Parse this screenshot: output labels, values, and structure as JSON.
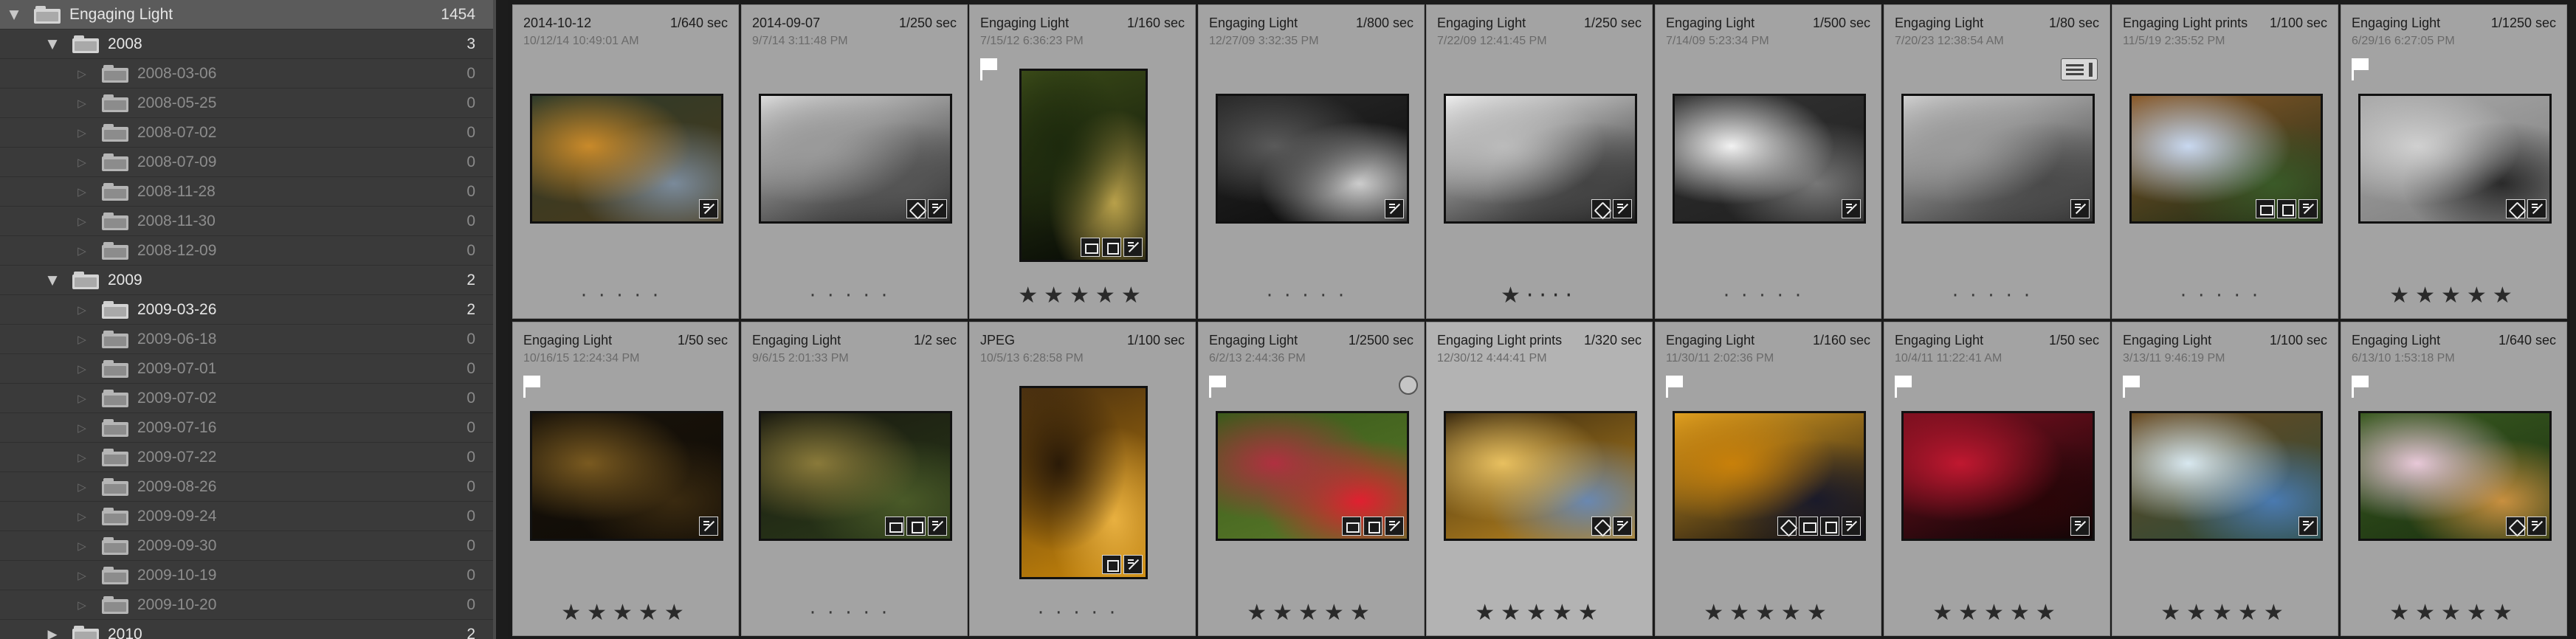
{
  "folders": [
    {
      "name": "Engaging Light",
      "count": "1454",
      "level": 0,
      "expanded": true,
      "root": true
    },
    {
      "name": "2008",
      "count": "3",
      "level": 1,
      "expanded": true
    },
    {
      "name": "2008-03-06",
      "count": "0",
      "level": 2,
      "dim": true
    },
    {
      "name": "2008-05-25",
      "count": "0",
      "level": 2,
      "dim": true
    },
    {
      "name": "2008-07-02",
      "count": "0",
      "level": 2,
      "dim": true
    },
    {
      "name": "2008-07-09",
      "count": "0",
      "level": 2,
      "dim": true
    },
    {
      "name": "2008-11-28",
      "count": "0",
      "level": 2,
      "dim": true
    },
    {
      "name": "2008-11-30",
      "count": "0",
      "level": 2,
      "dim": true
    },
    {
      "name": "2008-12-09",
      "count": "0",
      "level": 2,
      "dim": true
    },
    {
      "name": "2009",
      "count": "2",
      "level": 1,
      "expanded": true
    },
    {
      "name": "2009-03-26",
      "count": "2",
      "level": 2,
      "dim": false
    },
    {
      "name": "2009-06-18",
      "count": "0",
      "level": 2,
      "dim": true
    },
    {
      "name": "2009-07-01",
      "count": "0",
      "level": 2,
      "dim": true
    },
    {
      "name": "2009-07-02",
      "count": "0",
      "level": 2,
      "dim": true
    },
    {
      "name": "2009-07-16",
      "count": "0",
      "level": 2,
      "dim": true
    },
    {
      "name": "2009-07-22",
      "count": "0",
      "level": 2,
      "dim": true
    },
    {
      "name": "2009-08-26",
      "count": "0",
      "level": 2,
      "dim": true
    },
    {
      "name": "2009-09-24",
      "count": "0",
      "level": 2,
      "dim": true
    },
    {
      "name": "2009-09-30",
      "count": "0",
      "level": 2,
      "dim": true
    },
    {
      "name": "2009-10-19",
      "count": "0",
      "level": 2,
      "dim": true
    },
    {
      "name": "2009-10-20",
      "count": "0",
      "level": 2,
      "dim": true
    },
    {
      "name": "2010",
      "count": "2",
      "level": 1,
      "expanded": false
    }
  ],
  "photos": [
    {
      "line1": "2014-10-12",
      "line2": "10/12/14 10:49:01 AM",
      "shutter": "1/640 sec",
      "rating": 0,
      "flag": false,
      "orient": "land",
      "badges": [
        "edit"
      ],
      "colors": [
        "#4a3a1a",
        "#c98a2a",
        "#7a8a9a",
        "#2e3a2a"
      ]
    },
    {
      "line1": "2014-09-07",
      "line2": "9/7/14 3:11:48 PM",
      "shutter": "1/250 sec",
      "rating": 0,
      "flag": false,
      "orient": "land",
      "badges": [
        "key",
        "edit"
      ],
      "colors": [
        "#1a1a1a",
        "#9a9a9a",
        "#555555",
        "#dcdcdc"
      ]
    },
    {
      "line1": "Engaging Light",
      "line2": "7/15/12 6:36:23 PM",
      "shutter": "1/160 sec",
      "rating": 5,
      "flag": true,
      "orient": "port",
      "badges": [
        "crop",
        "coll",
        "edit"
      ],
      "colors": [
        "#050805",
        "#1d2a0d",
        "#b8a04a",
        "#3a4a18"
      ]
    },
    {
      "line1": "Engaging Light",
      "line2": "12/27/09 3:32:35 PM",
      "shutter": "1/800 sec",
      "rating": 0,
      "flag": false,
      "orient": "land",
      "badges": [
        "edit"
      ],
      "colors": [
        "#0a0a0a",
        "#5a5a5a",
        "#cccccc",
        "#2a2a2a"
      ]
    },
    {
      "line1": "Engaging Light",
      "line2": "7/22/09 12:41:45 PM",
      "shutter": "1/250 sec",
      "rating": 1,
      "flag": false,
      "orient": "land",
      "badges": [
        "key",
        "edit"
      ],
      "colors": [
        "#111111",
        "#bbbbbb",
        "#444444",
        "#eeeeee"
      ]
    },
    {
      "line1": "Engaging Light",
      "line2": "7/14/09 5:23:34 PM",
      "shutter": "1/500 sec",
      "rating": 0,
      "flag": false,
      "orient": "land",
      "badges": [
        "edit"
      ],
      "colors": [
        "#1e1e1e",
        "#f2f2f2",
        "#777777",
        "#333333"
      ]
    },
    {
      "line1": "Engaging Light",
      "line2": "7/20/23 12:38:54 AM",
      "shutter": "1/80 sec",
      "rating": 0,
      "flag": false,
      "orient": "land",
      "badges": [
        "edit"
      ],
      "meta": true,
      "colors": [
        "#2a2a2a",
        "#9a9a9a",
        "#4a4a4a",
        "#d0d0d0"
      ]
    },
    {
      "line1": "Engaging Light prints",
      "line2": "11/5/19 2:35:52 PM",
      "shutter": "1/100 sec",
      "rating": 0,
      "flag": false,
      "orient": "land",
      "badges": [
        "crop",
        "coll",
        "edit"
      ],
      "colors": [
        "#1a2a14",
        "#c8d8f0",
        "#3a5a28",
        "#8a5a2a"
      ]
    },
    {
      "line1": "Engaging Light",
      "line2": "6/29/16 6:27:05 PM",
      "shutter": "1/1250 sec",
      "rating": 5,
      "flag": true,
      "orient": "land",
      "badges": [
        "key",
        "edit"
      ],
      "colors": [
        "#7a7a7a",
        "#d0d0d0",
        "#2a2a2a",
        "#aaaaaa"
      ]
    },
    {
      "line1": "Engaging Light",
      "line2": "10/16/15 12:24:34 PM",
      "shutter": "1/50 sec",
      "rating": 5,
      "flag": true,
      "orient": "land",
      "badges": [
        "edit"
      ],
      "colors": [
        "#0e0a06",
        "#7a5a20",
        "#3a2a10",
        "#1a140a"
      ]
    },
    {
      "line1": "Engaging Light",
      "line2": "9/6/15 2:01:33 PM",
      "shutter": "1/2 sec",
      "rating": 0,
      "flag": false,
      "orient": "land",
      "badges": [
        "crop",
        "coll",
        "edit"
      ],
      "colors": [
        "#2a3a1a",
        "#8a7a3a",
        "#4a5a28",
        "#1a1a10"
      ]
    },
    {
      "line1": "JPEG",
      "line2": "10/5/13 6:28:58 PM",
      "shutter": "1/100 sec",
      "rating": 0,
      "flag": false,
      "orient": "port",
      "badges": [
        "coll",
        "edit"
      ],
      "colors": [
        "#c8860a",
        "#2a1a08",
        "#e8b040",
        "#4a3010"
      ]
    },
    {
      "line1": "Engaging Light",
      "line2": "6/2/13 2:44:36 PM",
      "shutter": "1/2500 sec",
      "rating": 5,
      "flag": true,
      "orient": "land",
      "badges": [
        "crop",
        "coll",
        "edit"
      ],
      "circle": true,
      "colors": [
        "#5a7a2a",
        "#b03040",
        "#e02030",
        "#3a5a1a"
      ]
    },
    {
      "line1": "Engaging Light prints",
      "line2": "12/30/12 4:44:41 PM",
      "shutter": "1/320 sec",
      "rating": 5,
      "flag": false,
      "orient": "land",
      "badges": [
        "key",
        "edit"
      ],
      "colors": [
        "#c08a20",
        "#e8c060",
        "#6a88b0",
        "#3a2a10"
      ]
    },
    {
      "line1": "Engaging Light",
      "line2": "11/30/11 2:02:36 PM",
      "shutter": "1/160 sec",
      "rating": 5,
      "flag": true,
      "orient": "land",
      "badges": [
        "key",
        "crop",
        "coll",
        "edit"
      ],
      "colors": [
        "#0a0a10",
        "#c8800a",
        "#1a1a2a",
        "#e0a020"
      ]
    },
    {
      "line1": "Engaging Light",
      "line2": "10/4/11 11:22:41 AM",
      "shutter": "1/50 sec",
      "rating": 5,
      "flag": true,
      "orient": "land",
      "badges": [
        "edit"
      ],
      "colors": [
        "#050505",
        "#c01830",
        "#2a0508",
        "#801020"
      ]
    },
    {
      "line1": "Engaging Light",
      "line2": "3/13/11 9:46:19 PM",
      "shutter": "1/100 sec",
      "rating": 5,
      "flag": true,
      "orient": "land",
      "badges": [
        "edit"
      ],
      "colors": [
        "#2a4a3a",
        "#d8e8f0",
        "#4a7ab0",
        "#6a4a20"
      ]
    },
    {
      "line1": "Engaging Light",
      "line2": "6/13/10 1:53:18 PM",
      "shutter": "1/640 sec",
      "rating": 5,
      "flag": true,
      "orient": "land",
      "badges": [
        "key",
        "edit"
      ],
      "colors": [
        "#1a3010",
        "#e8c8d8",
        "#c89040",
        "#3a5a20"
      ]
    }
  ]
}
